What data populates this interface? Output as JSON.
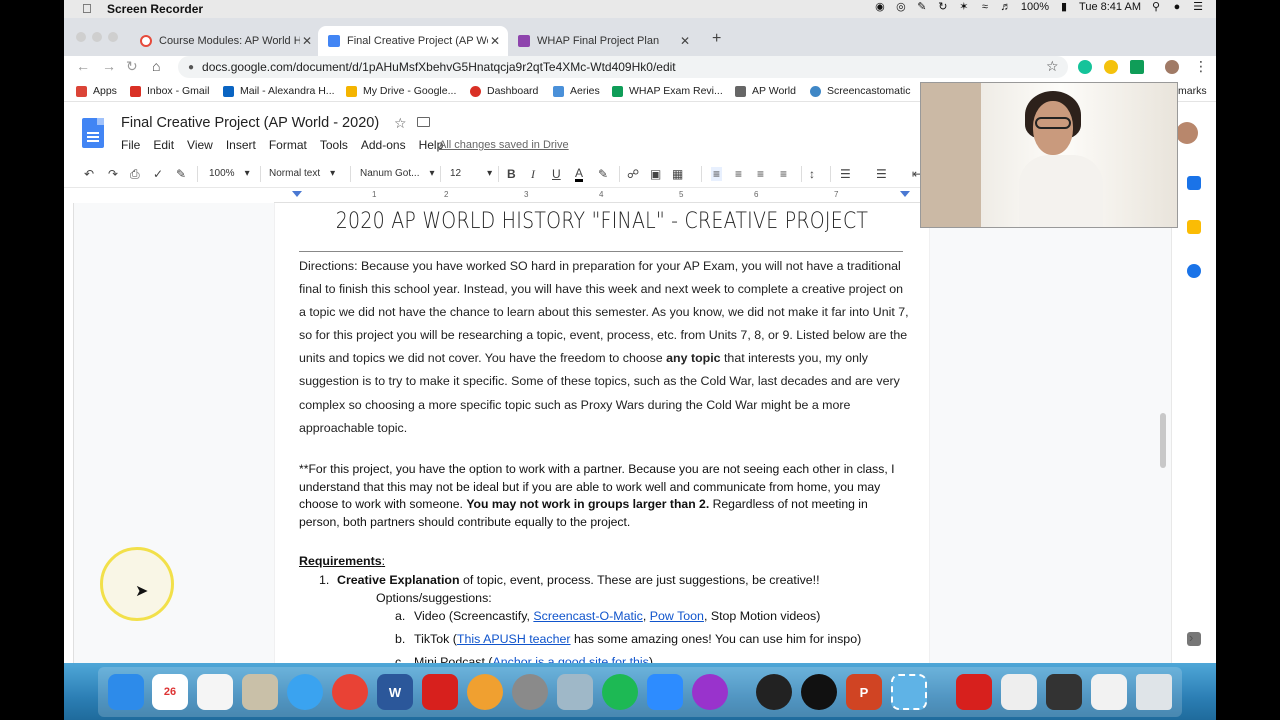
{
  "menubar": {
    "app_name": "Screen Recorder",
    "battery": "100%",
    "datetime": "Tue 8:41 AM"
  },
  "tabs": [
    {
      "title": "Course Modules: AP World His",
      "color": "#e64a3b"
    },
    {
      "title": "Final Creative Project (AP Worl",
      "color": "#4285f4"
    },
    {
      "title": "WHAP Final Project Plan",
      "color": "#8e44ad"
    }
  ],
  "address": {
    "url": "docs.google.com/document/d/1pAHuMsfXbehvG5Hnatqcja9r2qtTe4XMc-Wtd409Hk0/edit"
  },
  "bookmarks": [
    {
      "label": "Apps",
      "color": "#db4437"
    },
    {
      "label": "Inbox - Gmail",
      "color": "#d93025"
    },
    {
      "label": "Mail - Alexandra H...",
      "color": "#0a64c2"
    },
    {
      "label": "My Drive - Google...",
      "color": "#f4b400"
    },
    {
      "label": "Dashboard",
      "color": "#d93025"
    },
    {
      "label": "Aeries",
      "color": "#4a90d9"
    },
    {
      "label": "WHAP Exam Revi...",
      "color": "#0f9d58"
    },
    {
      "label": "AP World",
      "color": "#666666"
    },
    {
      "label": "Screencastomatic",
      "color": "#3f87c6"
    }
  ],
  "bookmarks_more": "marks",
  "doc": {
    "title": "Final Creative Project (AP World - 2020)",
    "menus": [
      "File",
      "Edit",
      "View",
      "Insert",
      "Format",
      "Tools",
      "Add-ons",
      "Help"
    ],
    "saved_status": "All changes saved in Drive"
  },
  "toolbar": {
    "zoom": "100%",
    "style": "Normal text",
    "font": "Nanum Got...",
    "size": "12"
  },
  "ruler_numbers": [
    "1",
    "1",
    "2",
    "3",
    "4",
    "5",
    "6",
    "7"
  ],
  "content": {
    "heading": "2020 AP WORLD HISTORY \"FINAL\" - CREATIVE PROJECT",
    "directions_a": "Directions: Because you have worked SO hard in preparation for your AP Exam, you will not have a traditional final to finish this school year. Instead, you will have this week and next week to complete a creative project on a topic we did not have the chance to learn about this semester. As you know, we did not make it far into Unit 7, so for this project you will be researching a topic, event, process, etc. from Units 7, 8, or 9. Listed below are the units and topics we did not cover. You have the freedom to choose ",
    "directions_bold": "any topic",
    "directions_b": " that interests you, my only suggestion is to try to make it specific. Some of these topics, such as the Cold War, last decades and are very complex so choosing a more specific topic such as Proxy Wars during the Cold War might be a more approachable topic.",
    "partner_a": "**For this project, you have the option to work with a partner. Because you are not seeing each other in class, I understand that this may not be ideal but if you are able to work well and communicate from home, you may choose to work with someone. ",
    "partner_bold": "You may not work in groups larger than 2.",
    "partner_b": " Regardless of not meeting in person, both partners should contribute equally to the project.",
    "requirements_title": "Requirements",
    "requirements_colon": ":",
    "req1_num": "1.",
    "req1_bold": "Creative Explanation",
    "req1_rest": " of topic, event, process. These are just suggestions, be creative!!",
    "options_label": "Options/suggestions:",
    "opt_a": {
      "marker": "a.",
      "pre": "Video (Screencastify, ",
      "link1": "Screencast-O-Matic",
      "mid": ", ",
      "link2": "Pow Toon",
      "post": ", Stop Motion videos)"
    },
    "opt_b": {
      "marker": "b.",
      "pre": "TikTok (",
      "link1": "This APUSH teacher",
      "post": " has some amazing ones! You can use him for inspo)"
    },
    "opt_c": {
      "marker": "c.",
      "pre": "Mini Podcast (",
      "link1": "Anchor is a good site for this",
      "post": ")"
    }
  }
}
